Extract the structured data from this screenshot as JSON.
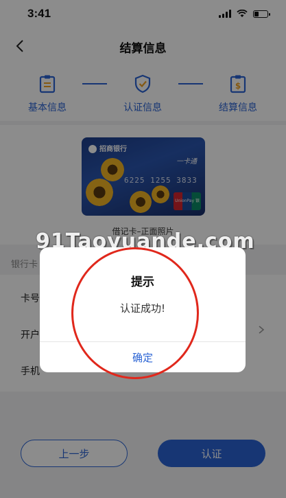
{
  "status_bar": {
    "time": "3:41",
    "battery_level": 0.35
  },
  "nav": {
    "title": "结算信息"
  },
  "steps": [
    {
      "label": "基本信息",
      "icon": "clipboard-icon"
    },
    {
      "label": "认证信息",
      "icon": "shield-check-icon"
    },
    {
      "label": "结算信息",
      "icon": "dollar-document-icon"
    }
  ],
  "card": {
    "bank_name": "招商银行",
    "product": "一卡通",
    "number_partial": "6225 1255 3833",
    "network": "UnionPay 银联",
    "caption": "借记卡–正面照片"
  },
  "form": {
    "section_label": "银行卡",
    "rows": [
      "卡号",
      "开户",
      "手机"
    ]
  },
  "buttons": {
    "prev": "上一步",
    "verify": "认证"
  },
  "watermark": "91Taoyuande.com",
  "dialog": {
    "title": "提示",
    "message": "认证成功!",
    "ok": "确定"
  },
  "colors": {
    "accent": "#2a63d4",
    "annotation": "#e0281c"
  }
}
